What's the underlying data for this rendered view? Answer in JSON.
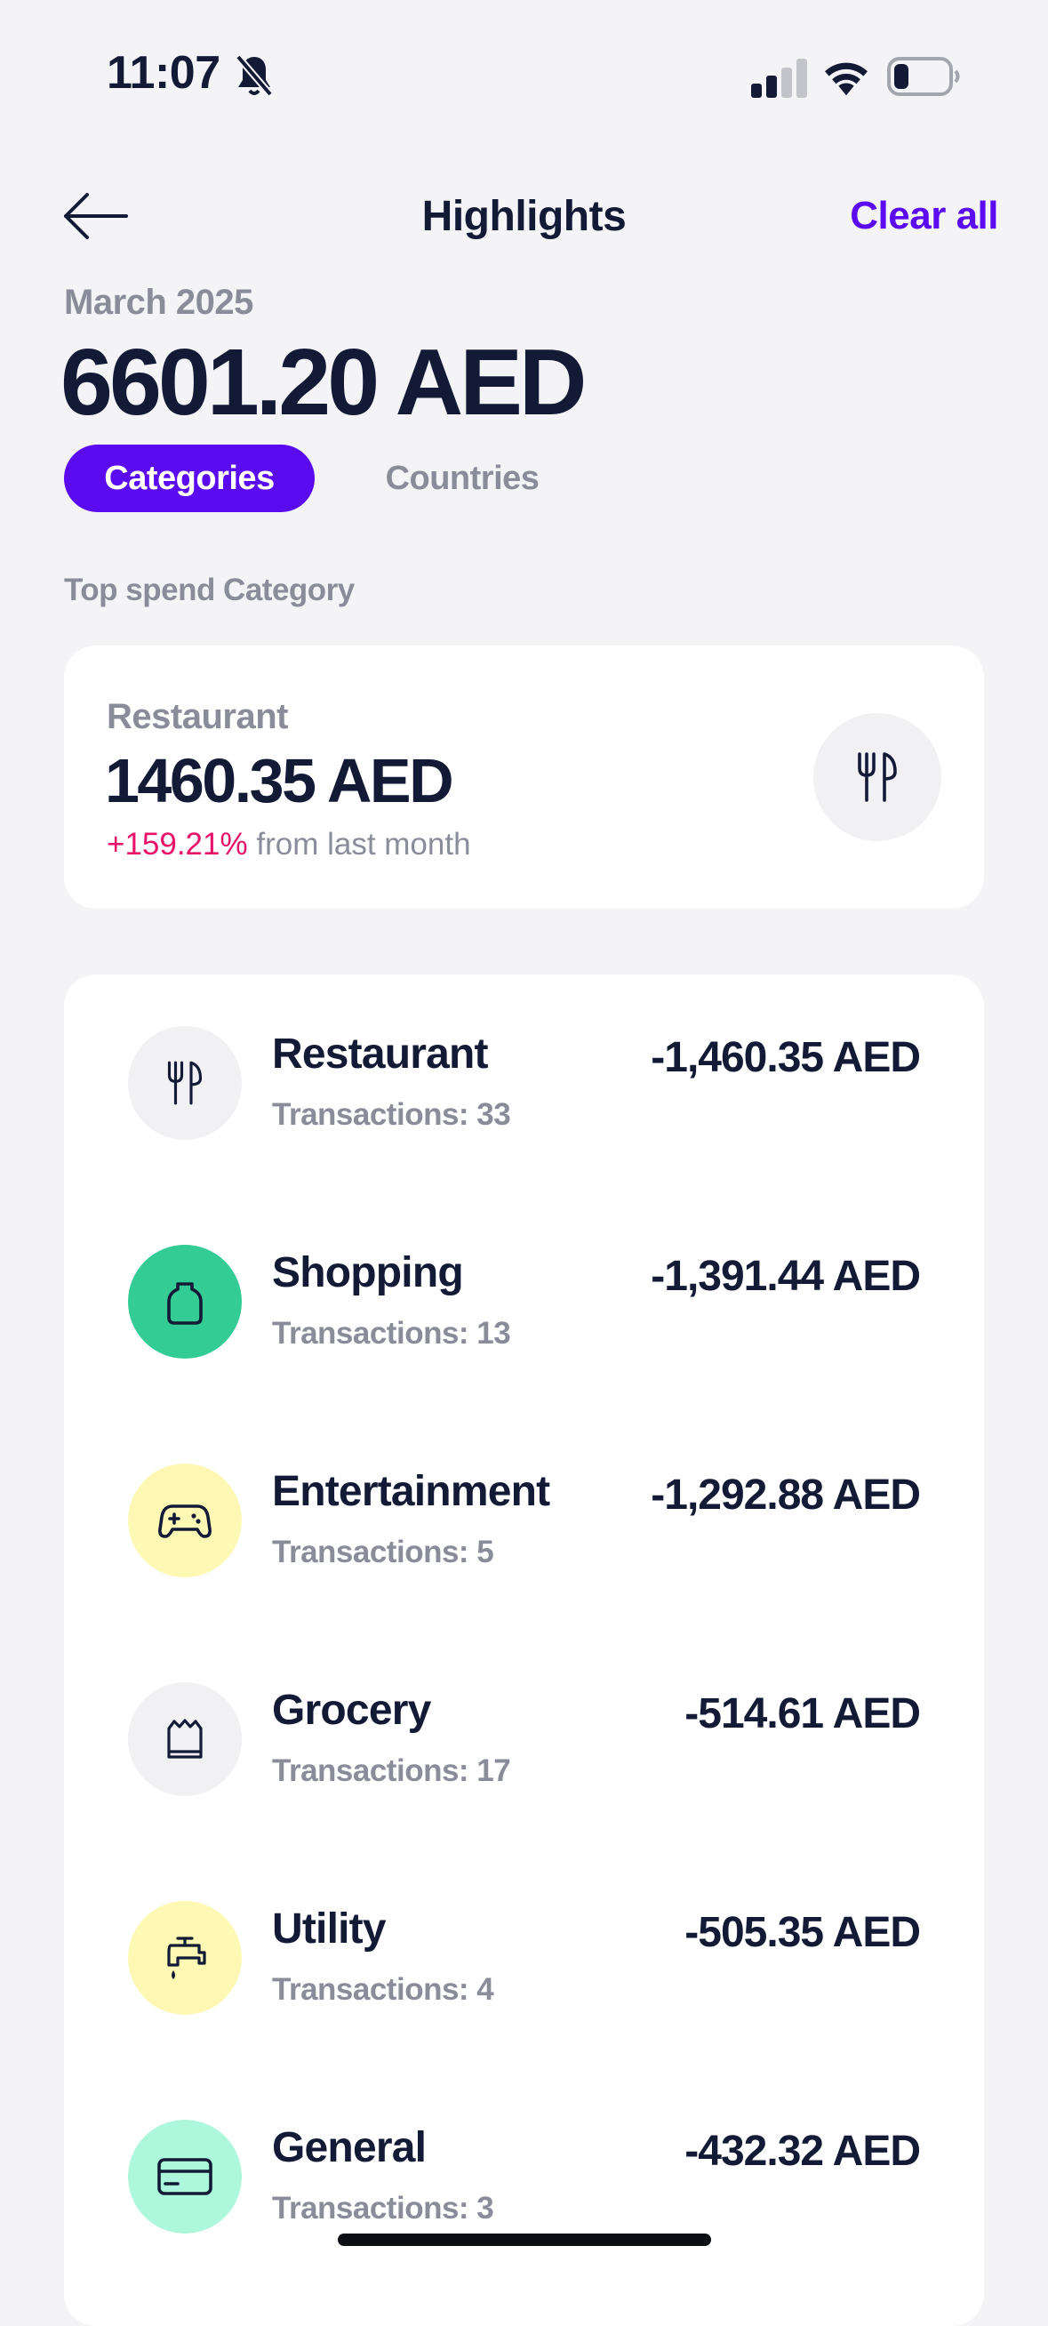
{
  "status_bar": {
    "time": "11:07",
    "icons": [
      "bell-slash-icon",
      "cellular-signal-icon",
      "wifi-icon",
      "battery-icon"
    ]
  },
  "header": {
    "title": "Highlights",
    "clear_all": "Clear all",
    "back_icon": "arrow-left-icon"
  },
  "summary": {
    "period": "March 2025",
    "total": "6601.20 AED"
  },
  "tabs": [
    {
      "label": "Categories",
      "active": true
    },
    {
      "label": "Countries",
      "active": false
    }
  ],
  "top_spend": {
    "section_label": "Top spend Category",
    "category": "Restaurant",
    "amount": "1460.35 AED",
    "change_pct": "+159.21%",
    "change_text": " from last month",
    "icon": "fork-knife-icon"
  },
  "categories": [
    {
      "name": "Restaurant",
      "transactions": "Transactions: 33",
      "amount": "-1,460.35 AED",
      "icon": "fork-knife-icon",
      "bg": "#f1f1f4"
    },
    {
      "name": "Shopping",
      "transactions": "Transactions: 13",
      "amount": "-1,391.44 AED",
      "icon": "shopping-tag-icon",
      "bg": "#33cc94"
    },
    {
      "name": "Entertainment",
      "transactions": "Transactions: 5",
      "amount": "-1,292.88 AED",
      "icon": "gamepad-icon",
      "bg": "#fdf9b4"
    },
    {
      "name": "Grocery",
      "transactions": "Transactions: 17",
      "amount": "-514.61 AED",
      "icon": "grocery-bag-icon",
      "bg": "#f1f1f4"
    },
    {
      "name": "Utility",
      "transactions": "Transactions: 4",
      "amount": "-505.35 AED",
      "icon": "water-tap-icon",
      "bg": "#fdf9b4"
    },
    {
      "name": "General",
      "transactions": "Transactions: 3",
      "amount": "-432.32 AED",
      "icon": "credit-card-icon",
      "bg": "#adf7dc"
    }
  ],
  "colors": {
    "accent": "#5b0bf0",
    "positive_change": "#e8116a",
    "text_primary": "#131a36",
    "text_secondary": "#8a8d99",
    "background": "#f4f4f7"
  }
}
